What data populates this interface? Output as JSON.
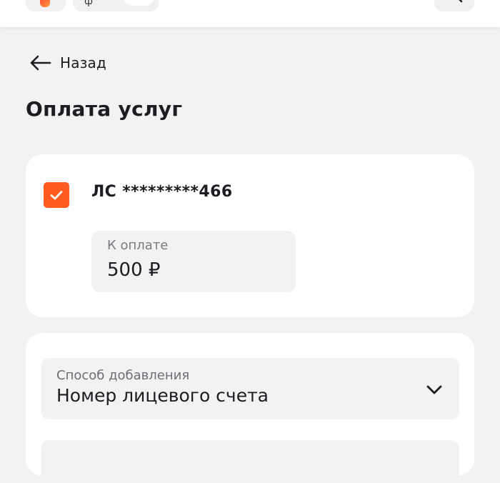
{
  "header": {
    "logo_icon": "brand-logo-icon",
    "search_icon": "search-icon"
  },
  "nav": {
    "back_label": "Назад",
    "back_icon": "arrow-left-icon"
  },
  "page": {
    "title": "Оплата услуг"
  },
  "account_card": {
    "checked": true,
    "account_label": "ЛС *********466",
    "amount_caption": "К оплате",
    "amount_value": "500 ₽"
  },
  "method_card": {
    "select_caption": "Способ добавления",
    "select_value": "Номер лицевого счета",
    "chevron_icon": "chevron-down-icon"
  },
  "colors": {
    "accent": "#ff5a1f",
    "background": "#f2f2f2",
    "card": "#ffffff",
    "text": "#1b1d22",
    "muted": "#777a80"
  }
}
